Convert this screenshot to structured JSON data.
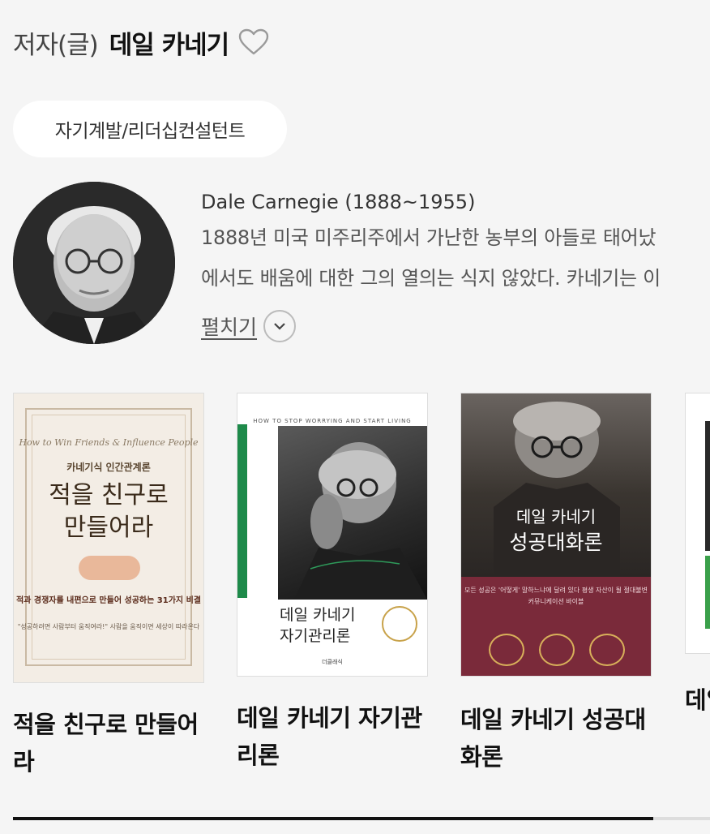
{
  "author": {
    "role": "저자(글)",
    "name": "데일 카네기",
    "category_tag": "자기계발/리더십컨설턴트",
    "bio_title": "Dale Carnegie (1888~1955)",
    "bio_lines": [
      "1888년 미국 미주리주에서 가난한 농부의 아들로 태어났",
      "에서도 배움에 대한 그의 열의는 식지 않았다. 카네기는 이"
    ],
    "expand_label": "펼치기"
  },
  "books": [
    {
      "title": "적을 친구로 만들어라",
      "cover": {
        "en_line": "How to Win Friends & Influence People",
        "subtitle": "카네기식 인간관계론",
        "line1": "적을 친구로",
        "line2": "만들어라",
        "blurb": "적과 경쟁자를 내편으로 만들어 성공하는 31가지 비결",
        "blurb2": "\"성공하려면 사람부터 움직여라!\" 사람을 움직이면 세상이 따라온다"
      }
    },
    {
      "title": "데일 카네기 자기관리론",
      "cover": {
        "top": "HOW TO STOP WORRYING AND START LIVING",
        "line1": "데일 카네기",
        "line2": "자기관리론",
        "publisher": "더클래식"
      }
    },
    {
      "title": "데일 카네기 성공대화론",
      "cover": {
        "line1": "데일 카네기",
        "line2": "성공대화론",
        "band": "모든 성공은 '어떻게' 말하느냐에 달려 있다 평생 자산이 될 절대불변 커뮤니케이션 바이블"
      }
    },
    {
      "title": "데일 카네기 자기계발"
    }
  ],
  "colors": {
    "background": "#f5f5f5",
    "accent_green": "#1e8a4a",
    "cover3_band": "#7a2a3a"
  },
  "icons": [
    "heart-outline-icon",
    "chevron-down-icon"
  ]
}
